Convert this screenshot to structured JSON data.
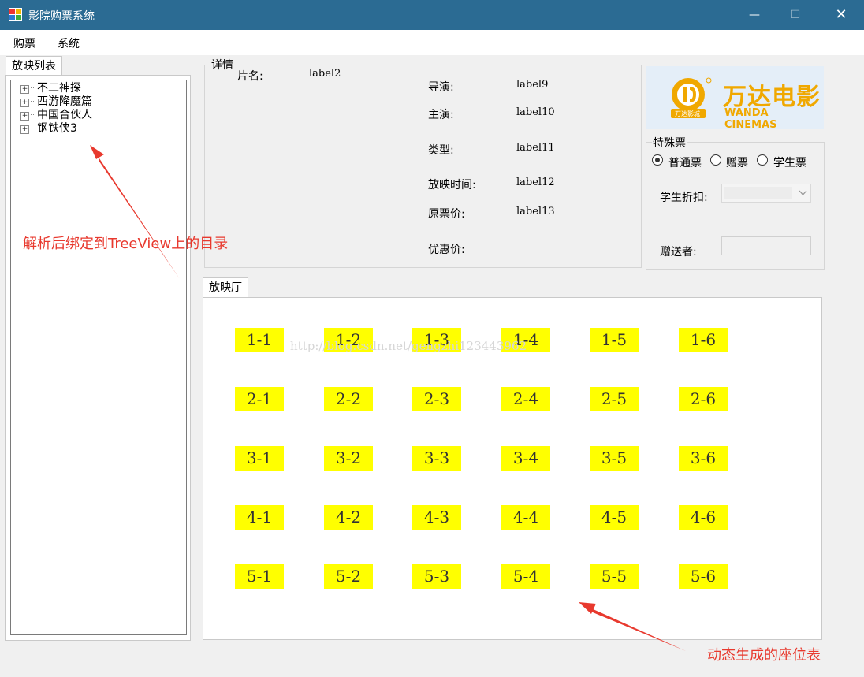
{
  "window": {
    "title": "影院购票系统",
    "minimize_glyph": "—",
    "maximize_glyph": "☐",
    "close_glyph": "✕"
  },
  "menu": {
    "items": [
      "购票",
      "系统"
    ]
  },
  "left_tab": {
    "label": "放映列表",
    "tree": [
      {
        "label": "不二神探"
      },
      {
        "label": "西游降魔篇"
      },
      {
        "label": "中国合伙人"
      },
      {
        "label": "钢铁侠3"
      }
    ]
  },
  "details": {
    "group_label": "详情",
    "movie_name_label": "片名:",
    "movie_name_value": "label2",
    "director_label": "导演:",
    "director_value": "label9",
    "actor_label": "主演:",
    "actor_value": "label10",
    "type_label": "类型:",
    "type_value": "label11",
    "time_label": "放映时间:",
    "time_value": "label12",
    "price_label": "原票价:",
    "price_value": "label13",
    "discount_price_label": "优惠价:"
  },
  "logo": {
    "cn": "万达电影",
    "en": "WANDA CINEMAS",
    "seal_text": "万达影城",
    "brand_color": "#f0a800"
  },
  "special_ticket": {
    "group_label": "特殊票",
    "options": [
      {
        "label": "普通票",
        "checked": true
      },
      {
        "label": "赠票",
        "checked": false
      },
      {
        "label": "学生票",
        "checked": false
      }
    ],
    "student_discount_label": "学生折扣:",
    "giver_label": "赠送者:"
  },
  "hall": {
    "tab_label": "放映厅",
    "seat_color": "#ffff00",
    "rows": [
      [
        "1-1",
        "1-2",
        "1-3",
        "1-4",
        "1-5",
        "1-6"
      ],
      [
        "2-1",
        "2-2",
        "2-3",
        "2-4",
        "2-5",
        "2-6"
      ],
      [
        "3-1",
        "3-2",
        "3-3",
        "3-4",
        "3-5",
        "3-6"
      ],
      [
        "4-1",
        "4-2",
        "4-3",
        "4-4",
        "4-5",
        "4-6"
      ],
      [
        "5-1",
        "5-2",
        "5-3",
        "5-4",
        "5-5",
        "5-6"
      ]
    ]
  },
  "watermark": "http://blog.csdn.net/gengzhi123443962",
  "annotations": {
    "tree_note": "解析后绑定到TreeView上的目录",
    "seat_note": "动态生成的座位表",
    "color": "#e8392e"
  }
}
